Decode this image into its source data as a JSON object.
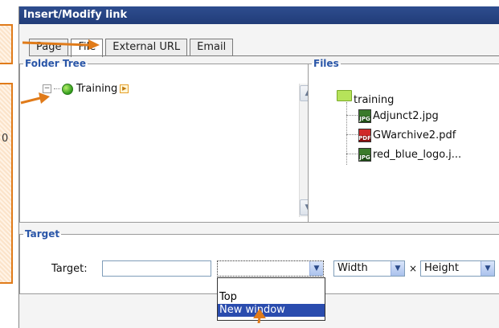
{
  "dialog": {
    "title": "Insert/Modify link",
    "tabs": [
      {
        "label": "Page",
        "active": false
      },
      {
        "label": "File",
        "active": true
      },
      {
        "label": "External URL",
        "active": false
      },
      {
        "label": "Email",
        "active": false
      }
    ]
  },
  "annotation": {
    "char_b": "0"
  },
  "folder_tree": {
    "legend": "Folder Tree",
    "root": {
      "label": "Training",
      "expander": "−"
    }
  },
  "files": {
    "legend": "Files",
    "folder": "training",
    "items": [
      {
        "name": "Adjunct2.jpg",
        "icon": "jpg-file-icon",
        "badge": "JPG"
      },
      {
        "name": "GWarchive2.pdf",
        "icon": "pdf-file-icon",
        "badge": "PDF"
      },
      {
        "name": "red_blue_logo.j...",
        "icon": "jpg-file-icon",
        "badge": "JPG"
      }
    ]
  },
  "target": {
    "legend": "Target",
    "label": "Target:",
    "value": "",
    "select_value": "",
    "options": [
      "Top",
      "New window"
    ],
    "selected_option": "New window",
    "width_label": "Width",
    "times": "×",
    "height_label": "Height"
  },
  "colors": {
    "titlebar": "#213c78",
    "legend": "#2a56a8",
    "annotation": "#e07b1a",
    "selection": "#2a4cae"
  }
}
